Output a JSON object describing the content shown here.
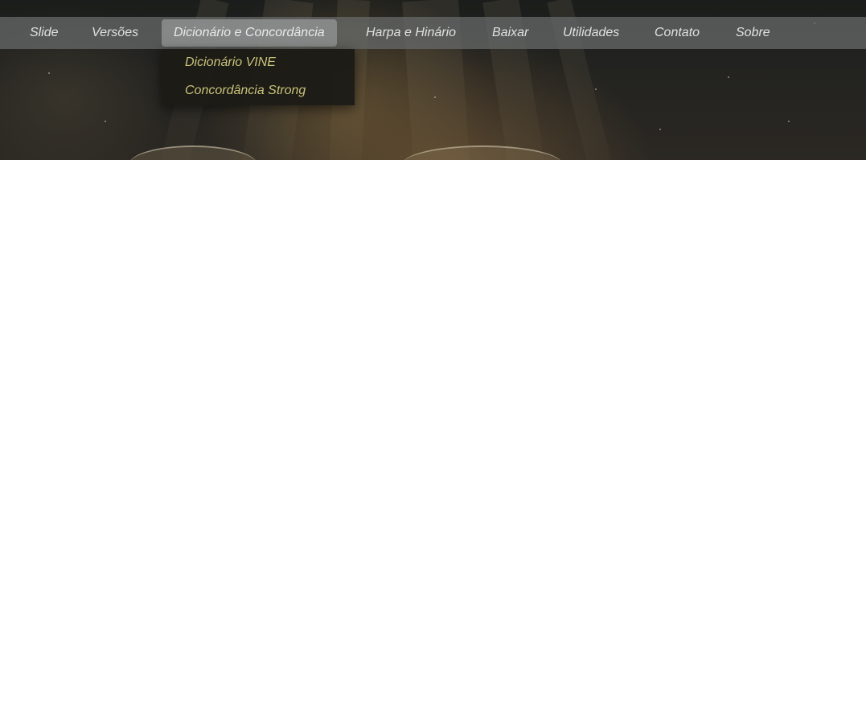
{
  "nav": {
    "items": [
      {
        "label": "Slide"
      },
      {
        "label": "Versões"
      },
      {
        "label": "Dicionário e Concordância",
        "active": true
      },
      {
        "label": "Harpa e Hinário"
      },
      {
        "label": "Baixar"
      },
      {
        "label": "Utilidades"
      },
      {
        "label": "Contato"
      },
      {
        "label": "Sobre"
      }
    ]
  },
  "dropdown": {
    "items": [
      {
        "label": "Dicionário VINE"
      },
      {
        "label": "Concordância Strong"
      }
    ]
  },
  "colors": {
    "nav_text": "#dfe2e2",
    "dropdown_text": "#c9c27a",
    "dropdown_bg": "#1c1b16"
  }
}
